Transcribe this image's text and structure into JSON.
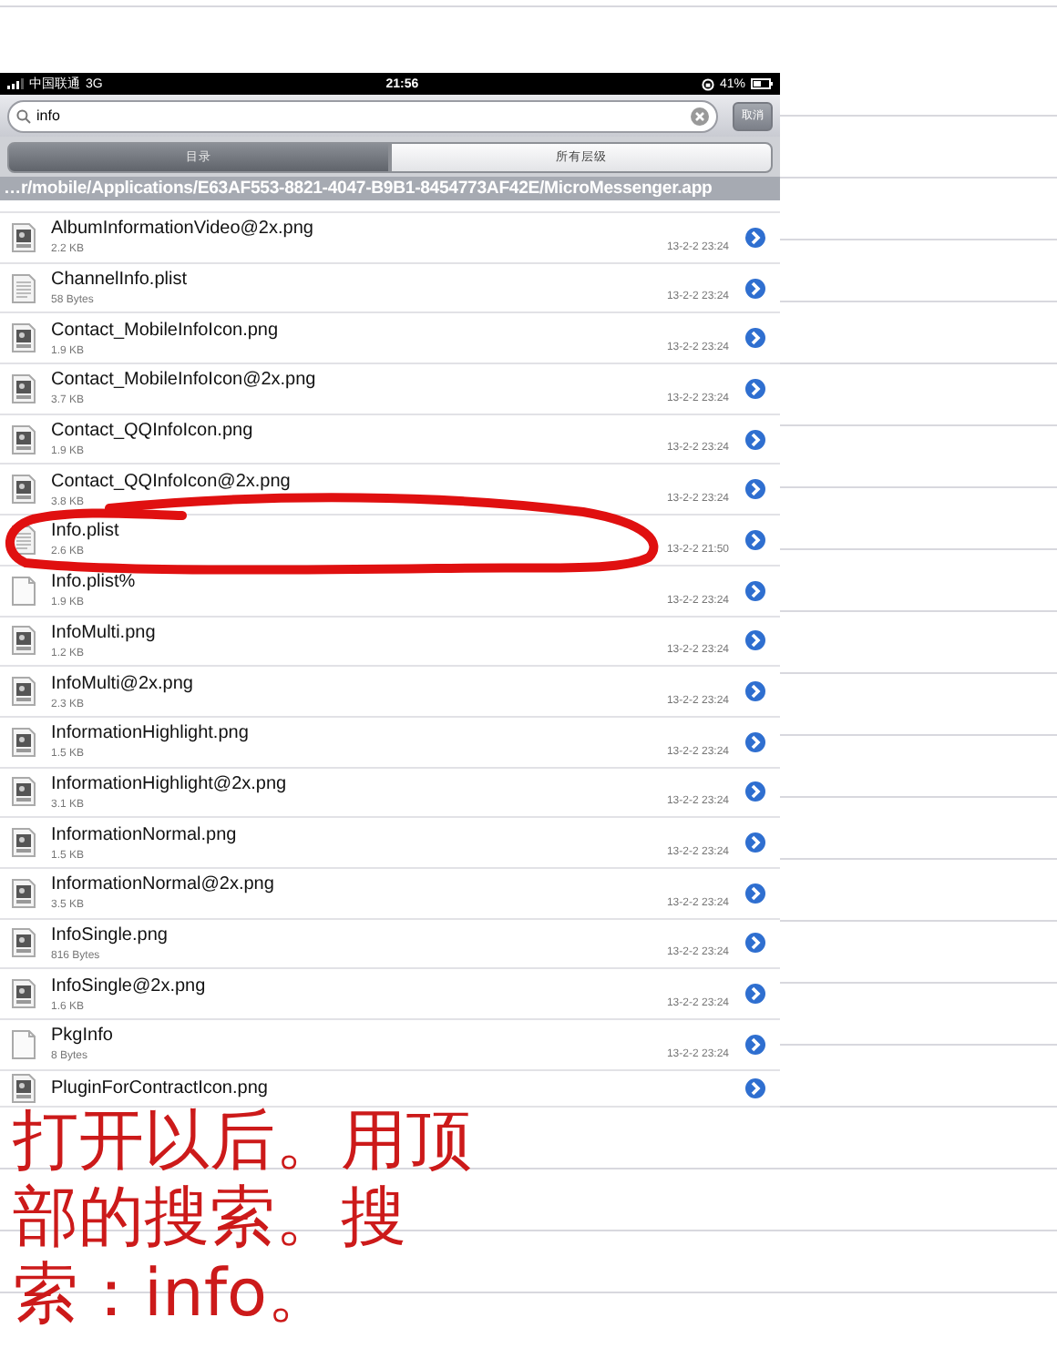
{
  "status_bar": {
    "carrier": "中国联通",
    "network": "3G",
    "time": "21:56",
    "battery": "41%"
  },
  "search": {
    "value": "info",
    "cancel": "取消"
  },
  "segments": [
    {
      "label": "目录",
      "selected": true
    },
    {
      "label": "所有层级",
      "selected": false
    }
  ],
  "path": "…r/mobile/Applications/E63AF553-8821-4047-B9B1-8454773AF42E/MicroMessenger.app",
  "files": [
    {
      "name": "AlbumInformationVideo@2x.png",
      "size": "2.2 KB",
      "date": "13-2-2 23:24",
      "kind": "png"
    },
    {
      "name": "ChannelInfo.plist",
      "size": "58 Bytes",
      "date": "13-2-2 23:24",
      "kind": "plist"
    },
    {
      "name": "Contact_MobileInfoIcon.png",
      "size": "1.9 KB",
      "date": "13-2-2 23:24",
      "kind": "png"
    },
    {
      "name": "Contact_MobileInfoIcon@2x.png",
      "size": "3.7 KB",
      "date": "13-2-2 23:24",
      "kind": "png"
    },
    {
      "name": "Contact_QQInfoIcon.png",
      "size": "1.9 KB",
      "date": "13-2-2 23:24",
      "kind": "png"
    },
    {
      "name": "Contact_QQInfoIcon@2x.png",
      "size": "3.8 KB",
      "date": "13-2-2 23:24",
      "kind": "png"
    },
    {
      "name": "Info.plist",
      "size": "2.6 KB",
      "date": "13-2-2 21:50",
      "kind": "plist"
    },
    {
      "name": "Info.plist%",
      "size": "1.9 KB",
      "date": "13-2-2 23:24",
      "kind": "file"
    },
    {
      "name": "InfoMulti.png",
      "size": "1.2 KB",
      "date": "13-2-2 23:24",
      "kind": "png"
    },
    {
      "name": "InfoMulti@2x.png",
      "size": "2.3 KB",
      "date": "13-2-2 23:24",
      "kind": "png"
    },
    {
      "name": "InformationHighlight.png",
      "size": "1.5 KB",
      "date": "13-2-2 23:24",
      "kind": "png"
    },
    {
      "name": "InformationHighlight@2x.png",
      "size": "3.1 KB",
      "date": "13-2-2 23:24",
      "kind": "png"
    },
    {
      "name": "InformationNormal.png",
      "size": "1.5 KB",
      "date": "13-2-2 23:24",
      "kind": "png"
    },
    {
      "name": "InformationNormal@2x.png",
      "size": "3.5 KB",
      "date": "13-2-2 23:24",
      "kind": "png"
    },
    {
      "name": "InfoSingle.png",
      "size": "816 Bytes",
      "date": "13-2-2 23:24",
      "kind": "png"
    },
    {
      "name": "InfoSingle@2x.png",
      "size": "1.6 KB",
      "date": "13-2-2 23:24",
      "kind": "png"
    },
    {
      "name": "PkgInfo",
      "size": "8 Bytes",
      "date": "13-2-2 23:24",
      "kind": "file"
    },
    {
      "name": "PluginForContractIcon.png",
      "kind": "png"
    }
  ],
  "caption_lines": [
    "打开以后。用顶",
    "部的搜索。搜",
    "索：info。"
  ]
}
